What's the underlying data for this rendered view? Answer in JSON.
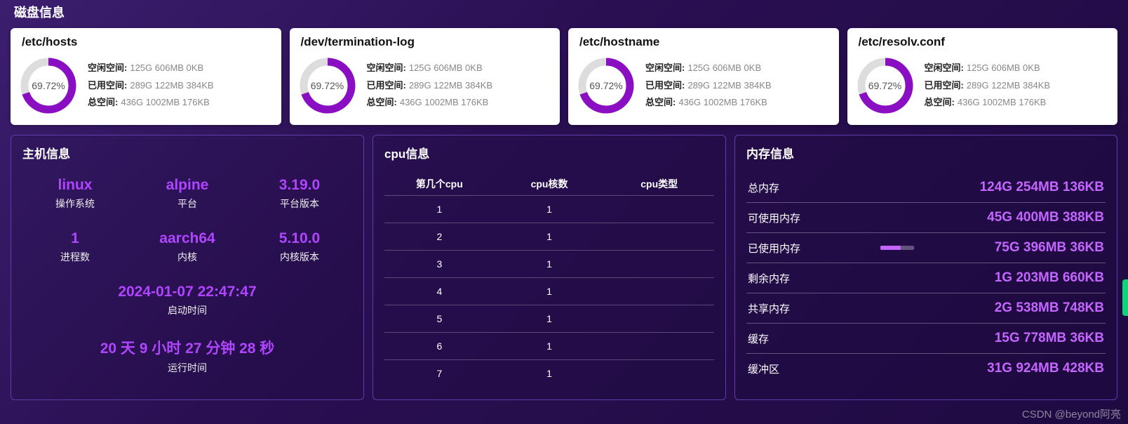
{
  "sections": {
    "disk": "磁盘信息",
    "host": "主机信息",
    "cpu": "cpu信息",
    "mem": "内存信息"
  },
  "disk_labels": {
    "free": "空闲空间:",
    "used": "已用空间:",
    "total": "总空间:"
  },
  "disks": [
    {
      "title": "/etc/hosts",
      "pct": "69.72%",
      "pct_num": 69.72,
      "free": "125G 606MB 0KB",
      "used": "289G 122MB 384KB",
      "total": "436G 1002MB 176KB"
    },
    {
      "title": "/dev/termination-log",
      "pct": "69.72%",
      "pct_num": 69.72,
      "free": "125G 606MB 0KB",
      "used": "289G 122MB 384KB",
      "total": "436G 1002MB 176KB"
    },
    {
      "title": "/etc/hostname",
      "pct": "69.72%",
      "pct_num": 69.72,
      "free": "125G 606MB 0KB",
      "used": "289G 122MB 384KB",
      "total": "436G 1002MB 176KB"
    },
    {
      "title": "/etc/resolv.conf",
      "pct": "69.72%",
      "pct_num": 69.72,
      "free": "125G 606MB 0KB",
      "used": "289G 122MB 384KB",
      "total": "436G 1002MB 176KB"
    }
  ],
  "host": {
    "os": {
      "v": "linux",
      "l": "操作系统"
    },
    "platform": {
      "v": "alpine",
      "l": "平台"
    },
    "platver": {
      "v": "3.19.0",
      "l": "平台版本"
    },
    "procs": {
      "v": "1",
      "l": "进程数"
    },
    "kernel": {
      "v": "aarch64",
      "l": "内核"
    },
    "kernver": {
      "v": "5.10.0",
      "l": "内核版本"
    },
    "boot": {
      "v": "2024-01-07 22:47:47",
      "l": "启动时间"
    },
    "uptime": {
      "v": "20 天 9 小时 27 分钟 28 秒",
      "l": "运行时间"
    }
  },
  "cpu": {
    "headers": {
      "idx": "第几个cpu",
      "cores": "cpu核数",
      "type": "cpu类型"
    },
    "rows": [
      {
        "idx": "1",
        "cores": "1",
        "type": ""
      },
      {
        "idx": "2",
        "cores": "1",
        "type": ""
      },
      {
        "idx": "3",
        "cores": "1",
        "type": ""
      },
      {
        "idx": "4",
        "cores": "1",
        "type": ""
      },
      {
        "idx": "5",
        "cores": "1",
        "type": ""
      },
      {
        "idx": "6",
        "cores": "1",
        "type": ""
      },
      {
        "idx": "7",
        "cores": "1",
        "type": ""
      }
    ]
  },
  "mem": [
    {
      "k": "总内存",
      "v": "124G 254MB 136KB",
      "bar": false
    },
    {
      "k": "可使用内存",
      "v": "45G 400MB 388KB",
      "bar": false
    },
    {
      "k": "已使用内存",
      "v": "75G 396MB 36KB",
      "bar": true
    },
    {
      "k": "剩余内存",
      "v": "1G 203MB 660KB",
      "bar": false
    },
    {
      "k": "共享内存",
      "v": "2G 538MB 748KB",
      "bar": false
    },
    {
      "k": "缓存",
      "v": "15G 778MB 36KB",
      "bar": false
    },
    {
      "k": "缓冲区",
      "v": "31G 924MB 428KB",
      "bar": false
    }
  ],
  "watermark": "CSDN @beyond阿亮"
}
